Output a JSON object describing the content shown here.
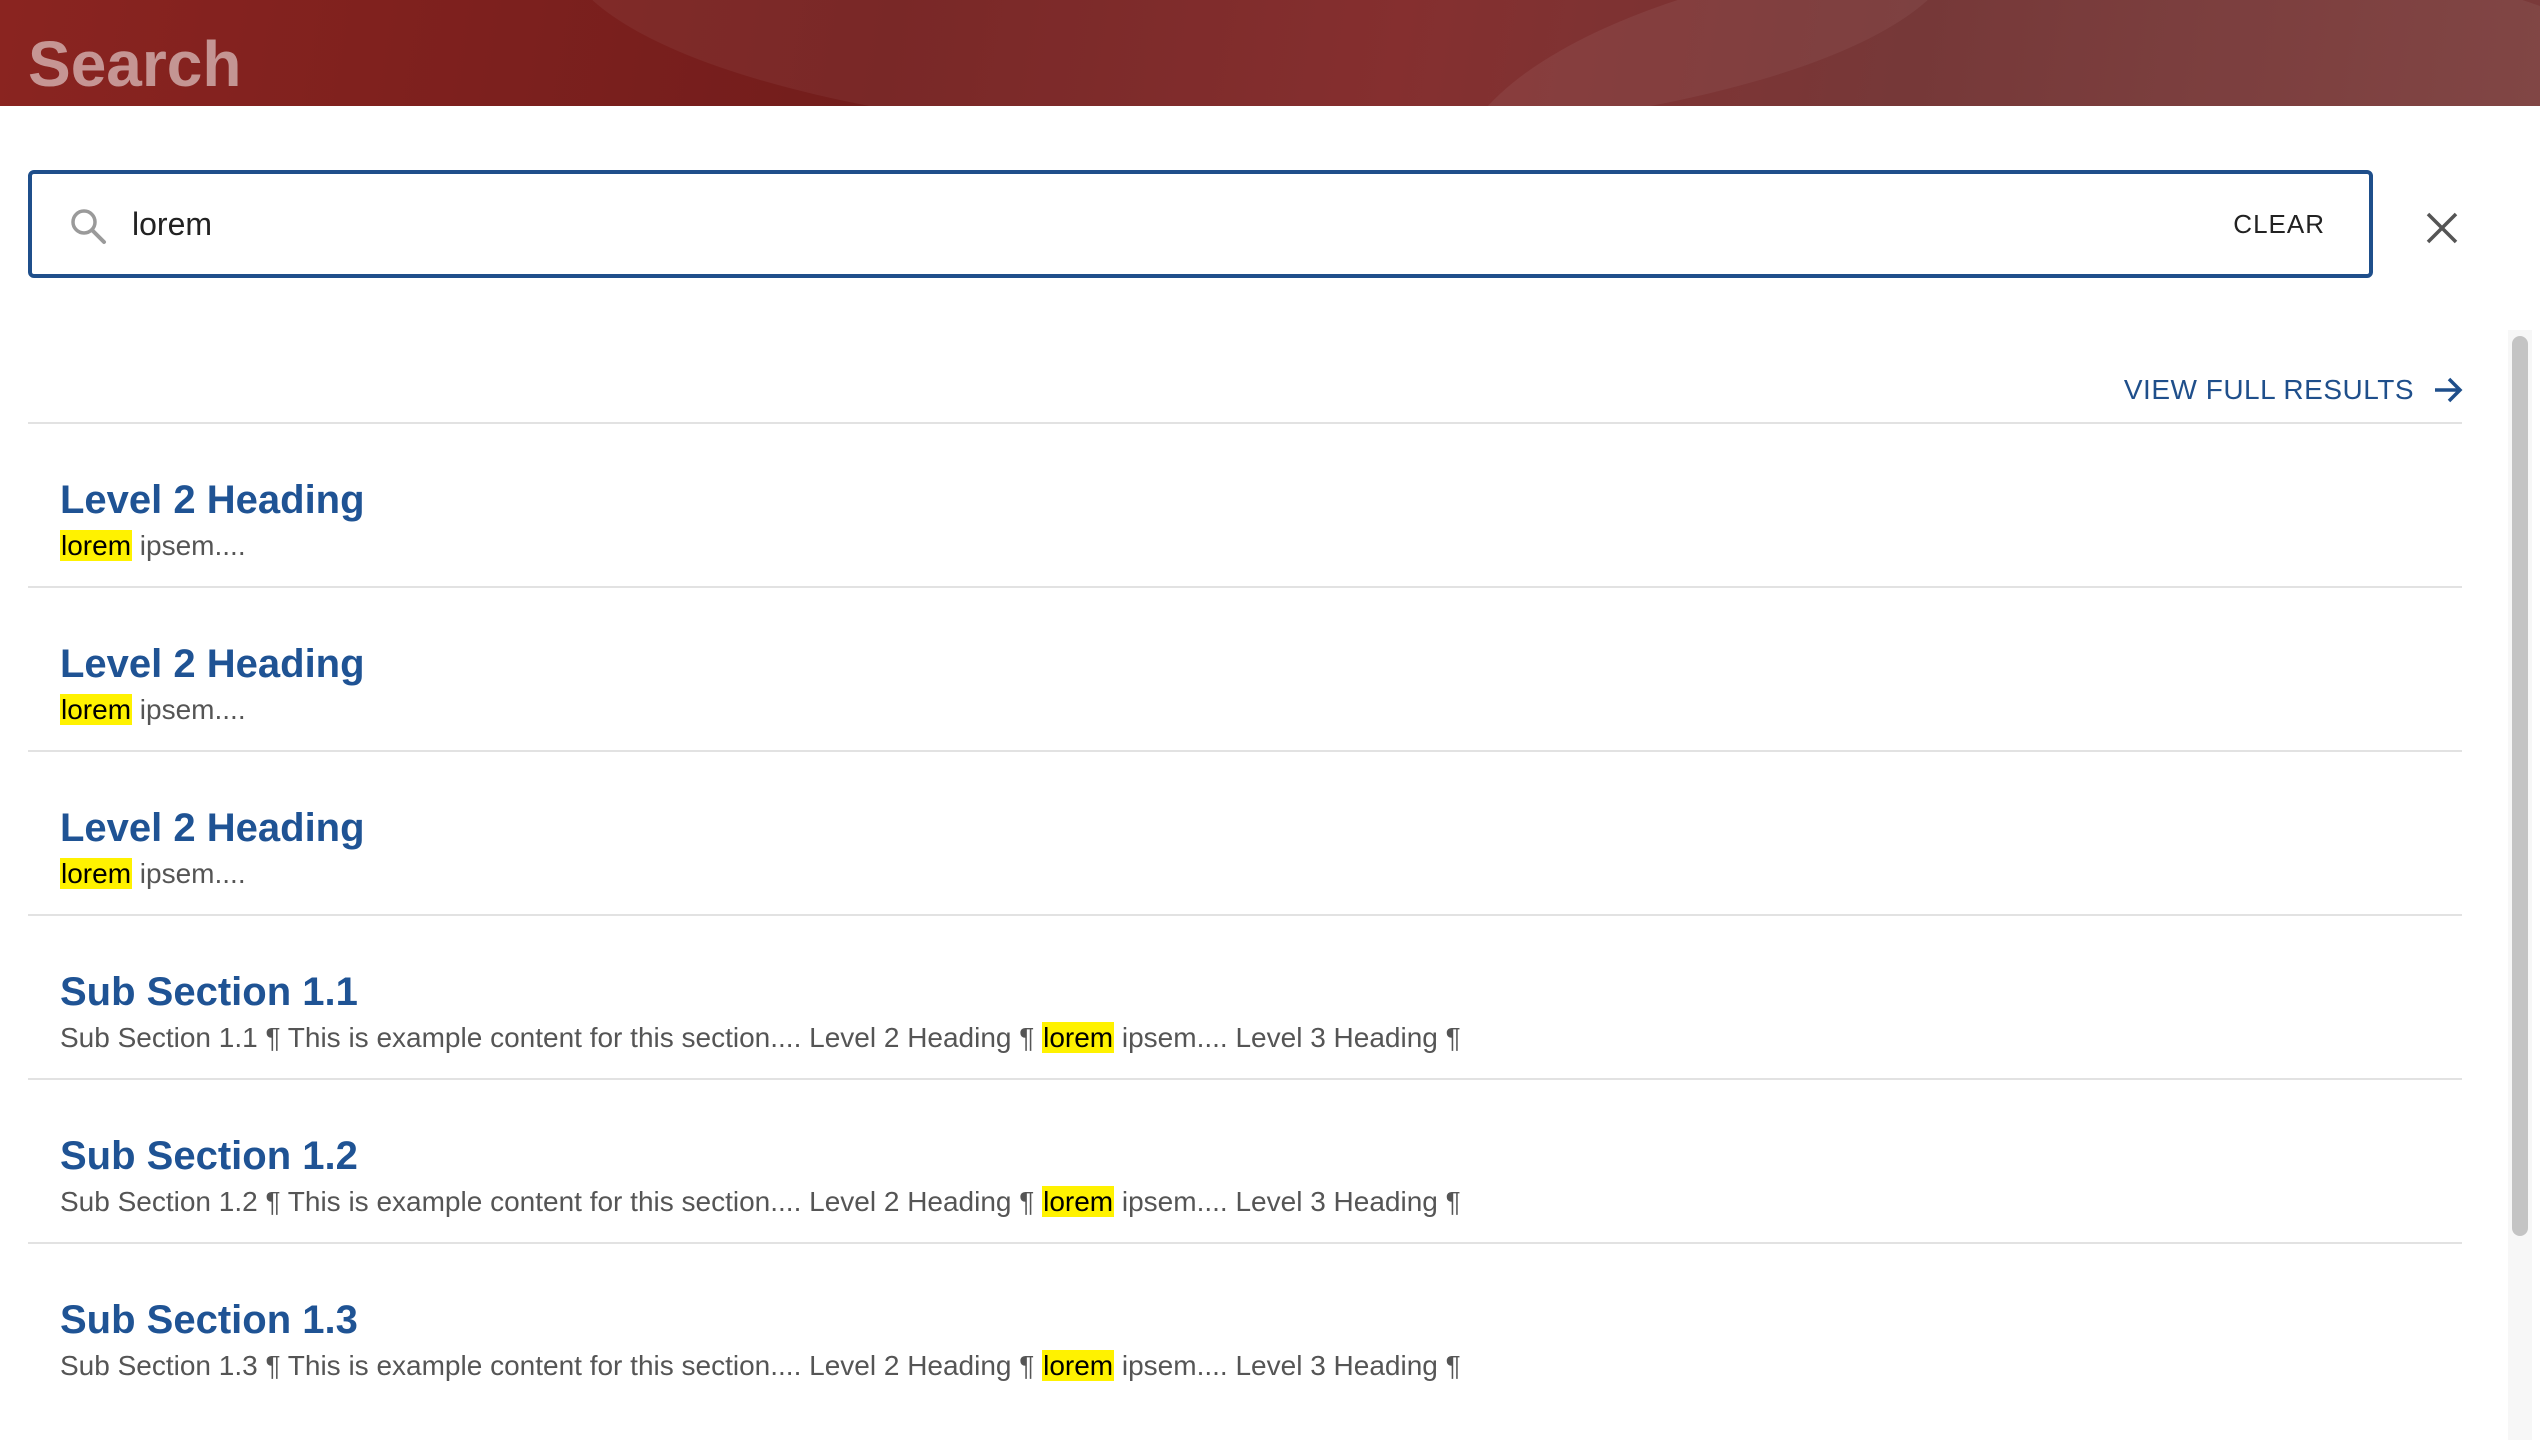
{
  "header": {
    "title": "Search"
  },
  "search": {
    "value": "lorem",
    "clear_label": "CLEAR"
  },
  "view_full_results": "VIEW FULL RESULTS",
  "results": [
    {
      "title": "Level 2 Heading",
      "snippet": {
        "before": "",
        "match": "lorem",
        "after": " ipsem...."
      }
    },
    {
      "title": "Level 2 Heading",
      "snippet": {
        "before": "",
        "match": "lorem",
        "after": " ipsem...."
      }
    },
    {
      "title": "Level 2 Heading",
      "snippet": {
        "before": "",
        "match": "lorem",
        "after": " ipsem...."
      }
    },
    {
      "title": "Sub Section 1.1",
      "snippet": {
        "before": "Sub Section 1.1 ¶ This is example content for this section.... Level 2 Heading ¶ ",
        "match": "lorem",
        "after": " ipsem.... Level 3 Heading ¶"
      }
    },
    {
      "title": "Sub Section 1.2",
      "snippet": {
        "before": "Sub Section 1.2 ¶ This is example content for this section.... Level 2 Heading ¶ ",
        "match": "lorem",
        "after": " ipsem.... Level 3 Heading ¶"
      }
    },
    {
      "title": "Sub Section 1.3",
      "snippet": {
        "before": "Sub Section 1.3 ¶ This is example content for this section.... Level 2 Heading ¶ ",
        "match": "lorem",
        "after": " ipsem.... Level 3 Heading ¶"
      }
    }
  ],
  "colors": {
    "accent": "#1f4f8b",
    "header_bg": "#7a2220",
    "highlight": "#fff200"
  }
}
